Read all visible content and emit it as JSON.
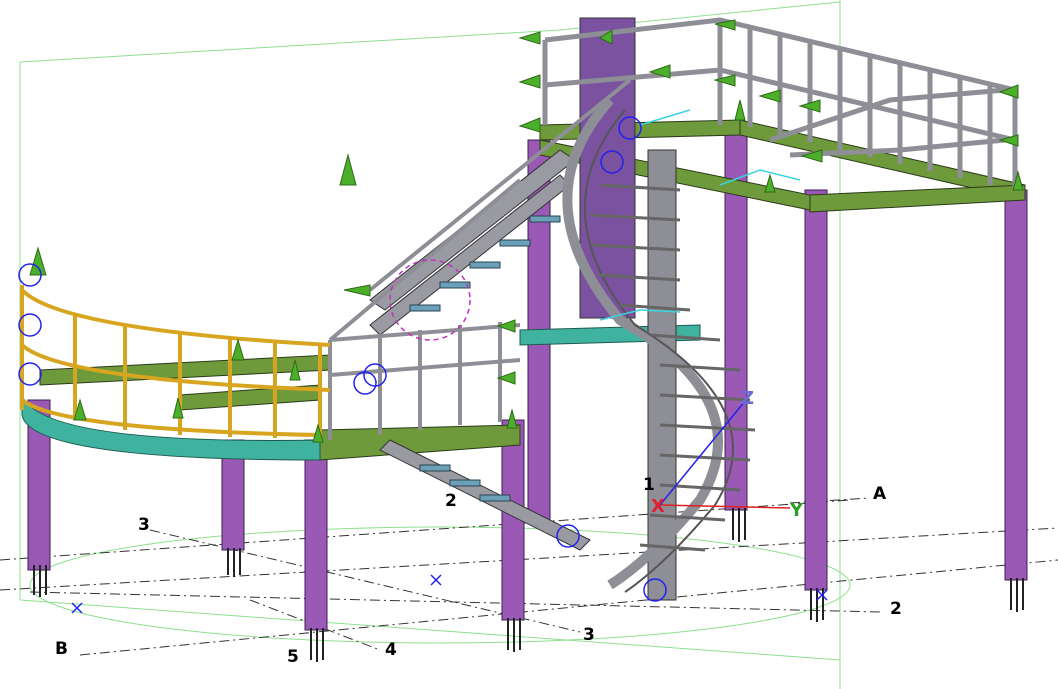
{
  "viewport": {
    "grid_labels": {
      "A": "A",
      "B": "B",
      "n2_left": "2",
      "n2_right": "2",
      "n3_left": "3",
      "n3_bottom": "3",
      "n4": "4",
      "n5": "5",
      "n1": "1"
    },
    "axes": {
      "x": "X",
      "y": "Y",
      "z": "Z"
    },
    "colors": {
      "column": "#9b59b6",
      "beam": "#6e9a3c",
      "curved_beam": "#3fb3a0",
      "handrail_gold": "#d7a51f",
      "steel": "#8e8e96",
      "support_arrow": "#4caf2a",
      "release_symbol": "#2222ee",
      "grid_line": "#333333",
      "bbox_green": "#7ee07e"
    }
  }
}
